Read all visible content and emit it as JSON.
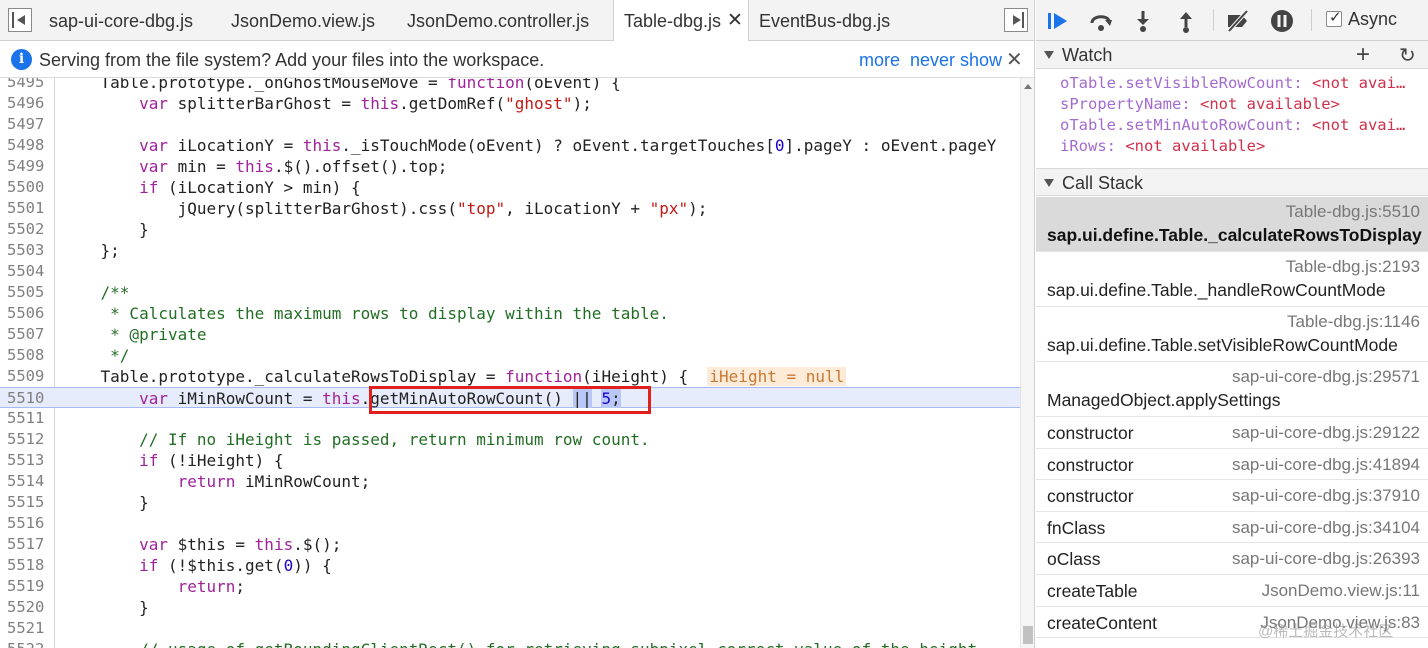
{
  "tabs": [
    {
      "label": "sap-ui-core-dbg.js",
      "active": false
    },
    {
      "label": "JsonDemo.view.js",
      "active": false
    },
    {
      "label": "JsonDemo.controller.js",
      "active": false
    },
    {
      "label": "Table-dbg.js",
      "active": true
    },
    {
      "label": "EventBus-dbg.js",
      "active": false
    }
  ],
  "tab_close_glyph": "✕",
  "infobar": {
    "message": "Serving from the file system? Add your files into the workspace.",
    "more": "more",
    "never_show": "never show",
    "close": "✕"
  },
  "code_lines": [
    {
      "n": "5495",
      "t": "    Table.prototype._onGhostMouseMove = function(oEvent) {"
    },
    {
      "n": "5496",
      "t": "        var splitterBarGhost = this.getDomRef(\"ghost\");"
    },
    {
      "n": "5497",
      "t": ""
    },
    {
      "n": "5498",
      "t": "        var iLocationY = this._isTouchMode(oEvent) ? oEvent.targetTouches[0].pageY : oEvent.pageY"
    },
    {
      "n": "5499",
      "t": "        var min = this.$().offset().top;"
    },
    {
      "n": "5500",
      "t": "        if (iLocationY > min) {"
    },
    {
      "n": "5501",
      "t": "            jQuery(splitterBarGhost).css(\"top\", iLocationY + \"px\");"
    },
    {
      "n": "5502",
      "t": "        }"
    },
    {
      "n": "5503",
      "t": "    };"
    },
    {
      "n": "5504",
      "t": ""
    },
    {
      "n": "5505",
      "t": "    /**"
    },
    {
      "n": "5506",
      "t": "     * Calculates the maximum rows to display within the table."
    },
    {
      "n": "5507",
      "t": "     * @private"
    },
    {
      "n": "5508",
      "t": "     */"
    },
    {
      "n": "5509",
      "t": "    Table.prototype._calculateRowsToDisplay = function(iHeight) {"
    },
    {
      "n": "5510",
      "t": "        var iMinRowCount = this.getMinAutoRowCount() || 5;"
    },
    {
      "n": "5511",
      "t": ""
    },
    {
      "n": "5512",
      "t": "        // If no iHeight is passed, return minimum row count."
    },
    {
      "n": "5513",
      "t": "        if (!iHeight) {"
    },
    {
      "n": "5514",
      "t": "            return iMinRowCount;"
    },
    {
      "n": "5515",
      "t": "        }"
    },
    {
      "n": "5516",
      "t": ""
    },
    {
      "n": "5517",
      "t": "        var $this = this.$();"
    },
    {
      "n": "5518",
      "t": "        if (!$this.get(0)) {"
    },
    {
      "n": "5519",
      "t": "            return;"
    },
    {
      "n": "5520",
      "t": "        }"
    },
    {
      "n": "5521",
      "t": ""
    },
    {
      "n": "5522",
      "t": "        // usage of getBoundingClientRect() for retrieving subpixel correct value of the height"
    }
  ],
  "current_line": "5510",
  "inline_value": "iHeight = null",
  "debugger": {
    "async_label": "Async",
    "async_checked": true
  },
  "watch": {
    "title": "Watch",
    "add_glyph": "+",
    "refresh_glyph": "↻",
    "items": [
      {
        "name": "oTable.setVisibleRowCount:",
        "value": "<not avai…"
      },
      {
        "name": "sPropertyName:",
        "value": "<not available>"
      },
      {
        "name": "oTable.setMinAutoRowCount:",
        "value": "<not avai…"
      },
      {
        "name": "iRows:",
        "value": "<not available>"
      }
    ]
  },
  "call_stack": {
    "title": "Call Stack",
    "frames": [
      {
        "fn": "sap.ui.define.Table._calculateRowsToDisplay",
        "loc": "Table-dbg.js:5510",
        "two_line": true,
        "selected": true
      },
      {
        "fn": "sap.ui.define.Table._handleRowCountMode",
        "loc": "Table-dbg.js:2193",
        "two_line": true,
        "selected": false
      },
      {
        "fn": "sap.ui.define.Table.setVisibleRowCountMode",
        "loc": "Table-dbg.js:1146",
        "two_line": true,
        "selected": false
      },
      {
        "fn": "ManagedObject.applySettings",
        "loc": "sap-ui-core-dbg.js:29571",
        "two_line": true,
        "selected": false
      },
      {
        "fn": "constructor",
        "loc": "sap-ui-core-dbg.js:29122",
        "two_line": false,
        "selected": false
      },
      {
        "fn": "constructor",
        "loc": "sap-ui-core-dbg.js:41894",
        "two_line": false,
        "selected": false
      },
      {
        "fn": "constructor",
        "loc": "sap-ui-core-dbg.js:37910",
        "two_line": false,
        "selected": false
      },
      {
        "fn": "fnClass",
        "loc": "sap-ui-core-dbg.js:34104",
        "two_line": false,
        "selected": false
      },
      {
        "fn": "oClass",
        "loc": "sap-ui-core-dbg.js:26393",
        "two_line": false,
        "selected": false
      },
      {
        "fn": "createTable",
        "loc": "JsonDemo.view.js:11",
        "two_line": false,
        "selected": false
      },
      {
        "fn": "createContent",
        "loc": "JsonDemo.view.js:83",
        "two_line": false,
        "selected": false
      }
    ]
  },
  "watermark": "@稀土掘金技术社区",
  "colors": {
    "accent": "#1a73e8",
    "keyword": "#a0229c",
    "string": "#c41a16",
    "number": "#1c00cf",
    "comment": "#236e25",
    "highlight_box": "#e0201c",
    "current_line_bg": "#e6ecfb"
  }
}
